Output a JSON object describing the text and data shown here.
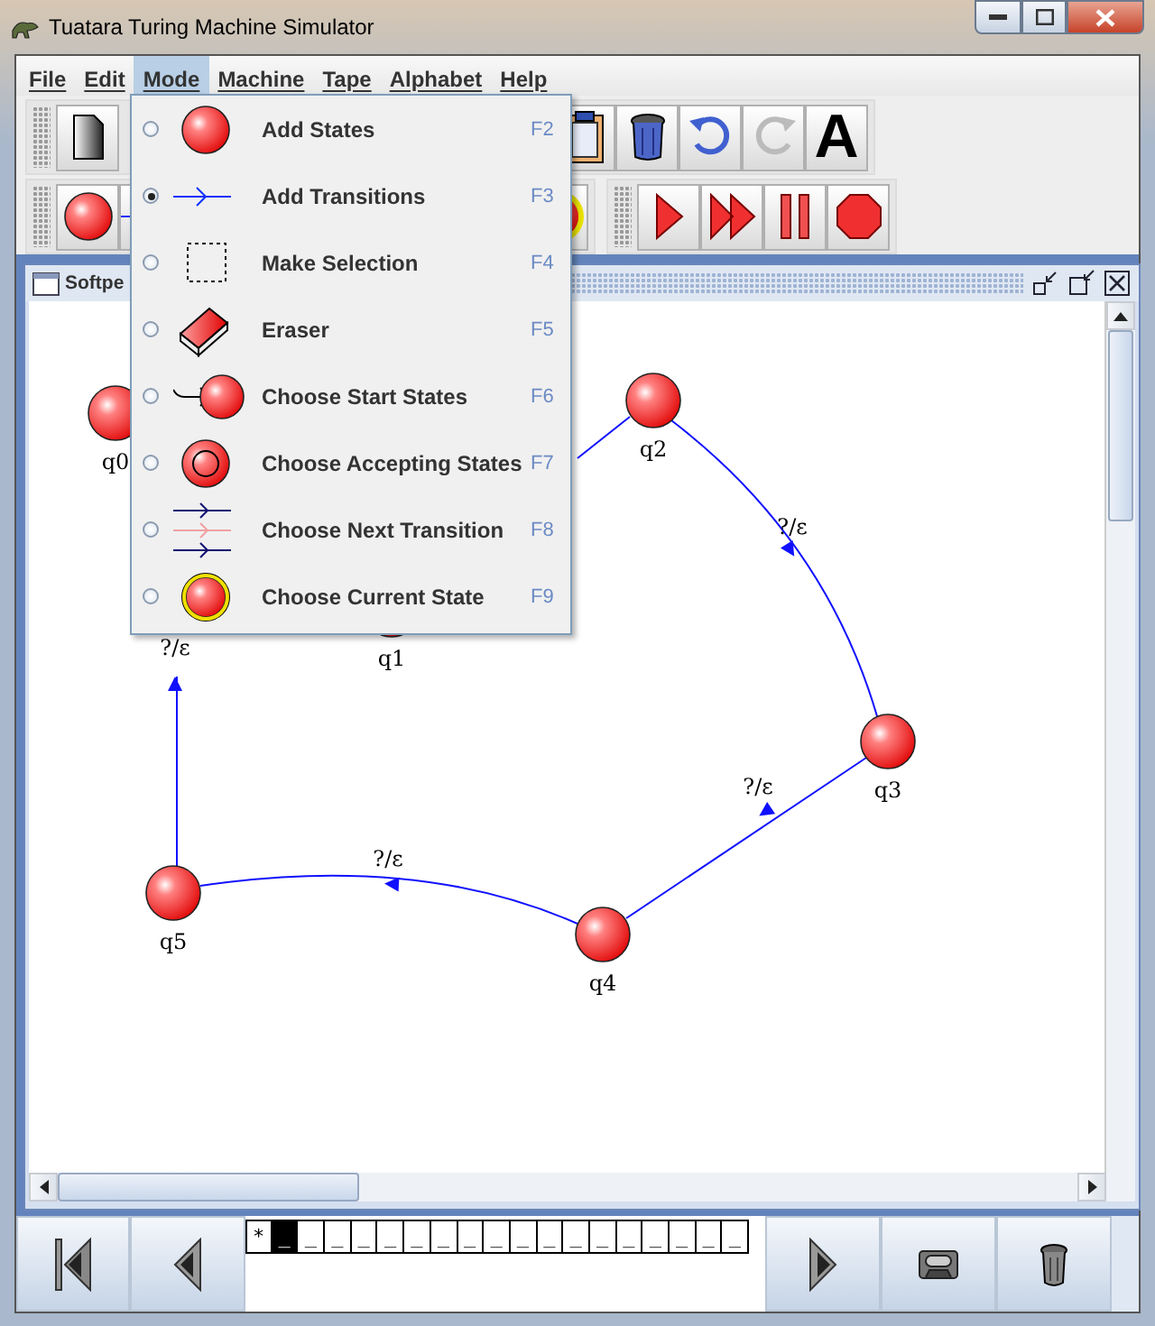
{
  "window": {
    "title": "Tuatara Turing Machine Simulator"
  },
  "menu_bar": [
    {
      "label": "File",
      "selected": false
    },
    {
      "label": "Edit",
      "selected": false
    },
    {
      "label": "Mode",
      "selected": true
    },
    {
      "label": "Machine",
      "selected": false
    },
    {
      "label": "Tape",
      "selected": false
    },
    {
      "label": "Alphabet",
      "selected": false
    },
    {
      "label": "Help",
      "selected": false
    }
  ],
  "redo_button": {
    "disabled": true
  },
  "text_button": {
    "label": "A"
  },
  "mode_menu": {
    "items": [
      {
        "label": "Add States",
        "shortcut": "F2",
        "selected": false
      },
      {
        "label": "Add Transitions",
        "shortcut": "F3",
        "selected": true
      },
      {
        "label": "Make Selection",
        "shortcut": "F4",
        "selected": false
      },
      {
        "label": "Eraser",
        "shortcut": "F5",
        "selected": false
      },
      {
        "label": "Choose Start States",
        "shortcut": "F6",
        "selected": false
      },
      {
        "label": "Choose Accepting States",
        "shortcut": "F7",
        "selected": false
      },
      {
        "label": "Choose Next Transition",
        "shortcut": "F8",
        "selected": false
      },
      {
        "label": "Choose Current State",
        "shortcut": "F9",
        "selected": false
      }
    ]
  },
  "machine_frame": {
    "title": "Softpe",
    "states": [
      {
        "name": "q0"
      },
      {
        "name": "q1"
      },
      {
        "name": "q2"
      },
      {
        "name": "q3"
      },
      {
        "name": "q4"
      },
      {
        "name": "q5"
      }
    ],
    "transitions": [
      {
        "label": "?/ε"
      },
      {
        "label": "?/ε"
      },
      {
        "label": "?/ε"
      },
      {
        "label": "?/ε"
      }
    ]
  },
  "tape": {
    "cells": [
      {
        "symbol": "*",
        "selected": false
      },
      {
        "symbol": "_",
        "selected": true
      },
      {
        "symbol": "_",
        "selected": false
      },
      {
        "symbol": "_",
        "selected": false
      },
      {
        "symbol": "_",
        "selected": false
      },
      {
        "symbol": "_",
        "selected": false
      },
      {
        "symbol": "_",
        "selected": false
      },
      {
        "symbol": "_",
        "selected": false
      },
      {
        "symbol": "_",
        "selected": false
      },
      {
        "symbol": "_",
        "selected": false
      },
      {
        "symbol": "_",
        "selected": false
      },
      {
        "symbol": "_",
        "selected": false
      },
      {
        "symbol": "_",
        "selected": false
      },
      {
        "symbol": "_",
        "selected": false
      },
      {
        "symbol": "_",
        "selected": false
      },
      {
        "symbol": "_",
        "selected": false
      },
      {
        "symbol": "_",
        "selected": false
      },
      {
        "symbol": "_",
        "selected": false
      },
      {
        "symbol": "_",
        "selected": false
      }
    ]
  }
}
